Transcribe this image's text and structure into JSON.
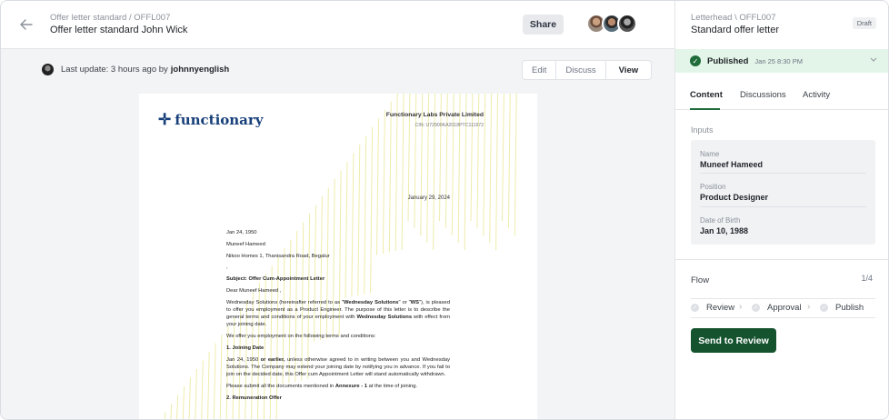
{
  "header": {
    "breadcrumb": "Offer letter standard / OFFL007",
    "title": "Offer letter standard John Wick",
    "share_label": "Share"
  },
  "toolbar": {
    "update_prefix": "Last update: 3 hours ago by",
    "update_user": "johnnyenglish",
    "modes": [
      "Edit",
      "Discuss",
      "View"
    ],
    "active_mode": "View"
  },
  "document": {
    "logo_text": "functionary",
    "company_name": "Functionary Labs Private Limited",
    "cin": "CIN: U72900KA2018PTC111972",
    "letter_date": "January 29, 2024",
    "date_line": "Jan 24, 1950",
    "recipient": "Muneef Hameed",
    "address": "Nikoo Homes 1, Thanisandra Road, Begalur",
    "address_extra": ",",
    "subject": "Subject: Offer Cum-Appointment Letter",
    "greeting": "Dear Muneef Hameed ,",
    "para1_a": "Wednesday Solutions (hereinafter referred to as \"",
    "para1_b": "Wednesday Solutions",
    "para1_c": "\" or \"",
    "para1_d": "WS",
    "para1_e": "\"), is pleased to offer you employment as a Product Engineer. The purpose of this letter is to describe the general terms and conditions of your employment with ",
    "para1_f": "Wednesday Solutions",
    "para1_g": " with effect from your joining date.",
    "para2": "We offer you employment on the following terms and conditions:",
    "sec1_title": "1. Joining Date",
    "sec1_a": "Jan 24, 1950 ",
    "sec1_b": "or earlier,",
    "sec1_c": " unless otherwise agreed to in writing between you and Wednesday Solutions. The Company may extend your joining date by notifying you in advance. If you fail to join on the decided date, this Offer cum Appointment Letter will stand automatically withdrawn.",
    "sec1_d": "Please submit all the documents mentioned in ",
    "sec1_e": "Annexure - 1",
    "sec1_f": " at the time of joining.",
    "sec2_title": "2. Remuneration Offer"
  },
  "side": {
    "breadcrumb": "Letterhead \\ OFFL007",
    "title": "Standard offer letter",
    "badge": "Draft",
    "status_label": "Published",
    "status_date": "Jan 25 8:30 PM",
    "tabs": [
      "Content",
      "Discussions",
      "Activity"
    ],
    "inputs_label": "Inputs",
    "fields": [
      {
        "label": "Name",
        "value": "Muneef Hameed"
      },
      {
        "label": "Position",
        "value": "Product Designer"
      },
      {
        "label": "Date of Birth",
        "value": "Jan 10, 1988"
      }
    ],
    "flow_label": "Flow",
    "flow_count": "1/4",
    "steps": [
      "Review",
      "Approval",
      "Publish"
    ],
    "send_label": "Send to Review"
  },
  "colors": {
    "accent": "#15532f",
    "published_bg": "#e3f5e9",
    "logo": "#173f7a"
  }
}
